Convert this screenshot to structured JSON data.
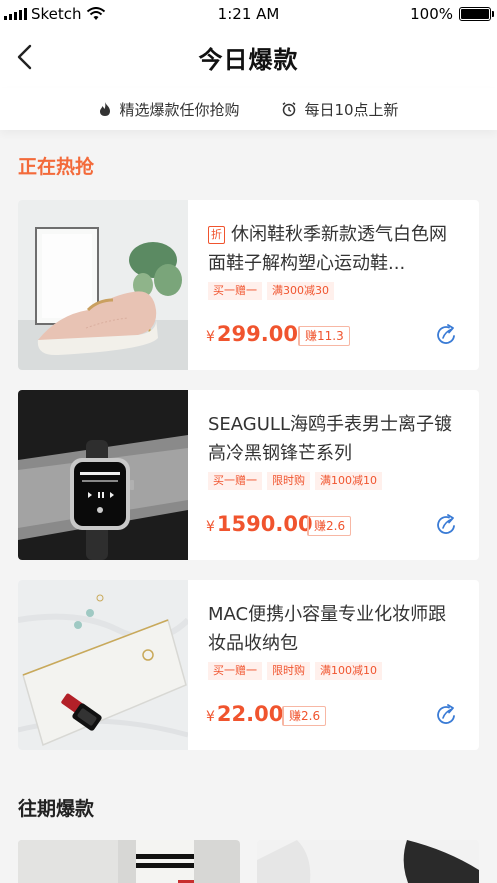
{
  "status_bar": {
    "carrier": "Sketch",
    "time": "1:21 AM",
    "battery": "100%"
  },
  "nav": {
    "title": "今日爆款"
  },
  "sub_bar": {
    "left_text": "精选爆款任你抢购",
    "right_text": "每日10点上新"
  },
  "sections": {
    "hot": "正在热抢",
    "past": "往期爆款"
  },
  "products": [
    {
      "badge": "折",
      "title": "休闲鞋秋季新款透气白色网面鞋子解构塑心运动鞋...",
      "tags": [
        "买一赠一",
        "满300减30"
      ],
      "currency": "¥",
      "price": "299.00",
      "earn": "赚11.3",
      "image": "pink-sneakers"
    },
    {
      "badge": "",
      "title": "SEAGULL海鸥手表男士离子镀高冷黑钢锋芒系列",
      "tags": [
        "买一赠一",
        "限时购",
        "满100减10"
      ],
      "currency": "¥",
      "price": "1590.00",
      "earn": "赚2.6",
      "image": "smartwatch"
    },
    {
      "badge": "",
      "title": "MAC便携小容量专业化妆师跟妆品收纳包",
      "tags": [
        "买一赠一",
        "限时购",
        "满100减10"
      ],
      "currency": "¥",
      "price": "22.00",
      "earn": "赚2.6",
      "image": "cosmetic-bag"
    }
  ],
  "colors": {
    "accent": "#f0542e",
    "section_hot": "#f36a3a",
    "share_icon": "#3a7bd5"
  }
}
